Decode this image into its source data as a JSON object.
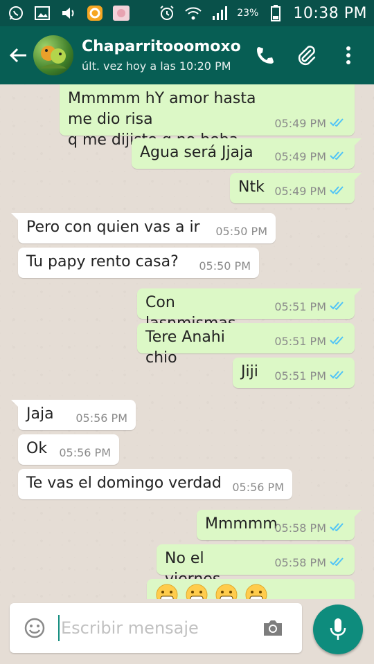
{
  "status_bar": {
    "battery": "23%",
    "time": "10:38 PM",
    "icons_left": [
      "whatsapp-icon",
      "image-icon",
      "volume-icon",
      "app-icon",
      "photo-icon"
    ],
    "icons_right": [
      "alarm-icon",
      "wifi-icon",
      "signal-icon",
      "battery-icon"
    ]
  },
  "header": {
    "contact_name": "Chaparritooomoxo",
    "last_seen": "últ. vez hoy a las 10:20 PM",
    "accent_color": "#075e54"
  },
  "messages": [
    {
      "dir": "out",
      "text": "Mmmmm hY amor hasta me dio risa\nq me dijiste q no beba",
      "time": "05:49 PM",
      "status": "read"
    },
    {
      "dir": "out",
      "text": "Agua será Jjaja",
      "time": "05:49 PM",
      "status": "read"
    },
    {
      "dir": "out",
      "text": "Ntk",
      "time": "05:49 PM",
      "status": "read"
    },
    {
      "dir": "in",
      "text": "Pero con quien vas a ir",
      "time": "05:50 PM"
    },
    {
      "dir": "in",
      "text": "Tu papy rento casa?",
      "time": "05:50 PM"
    },
    {
      "dir": "out",
      "text": "Con lasnmismas",
      "time": "05:51 PM",
      "status": "read"
    },
    {
      "dir": "out",
      "text": "Tere Anahi chio",
      "time": "05:51 PM",
      "status": "read"
    },
    {
      "dir": "out",
      "text": "Jiji",
      "time": "05:51 PM",
      "status": "read"
    },
    {
      "dir": "in",
      "text": "Jaja",
      "time": "05:56 PM"
    },
    {
      "dir": "in",
      "text": "Ok",
      "time": "05:56 PM"
    },
    {
      "dir": "in",
      "text": "Te vas el domingo verdad",
      "time": "05:56 PM"
    },
    {
      "dir": "out",
      "text": "Mmmmm",
      "time": "05:58 PM",
      "status": "read"
    },
    {
      "dir": "out",
      "text": "No el viernes",
      "time": "05:58 PM",
      "status": "read"
    },
    {
      "dir": "out",
      "emoji": [
        "grimace-emoji",
        "grimace-emoji",
        "grimace-emoji",
        "grimace-emoji"
      ]
    }
  ],
  "composer": {
    "placeholder": "Escribir mensaje"
  }
}
